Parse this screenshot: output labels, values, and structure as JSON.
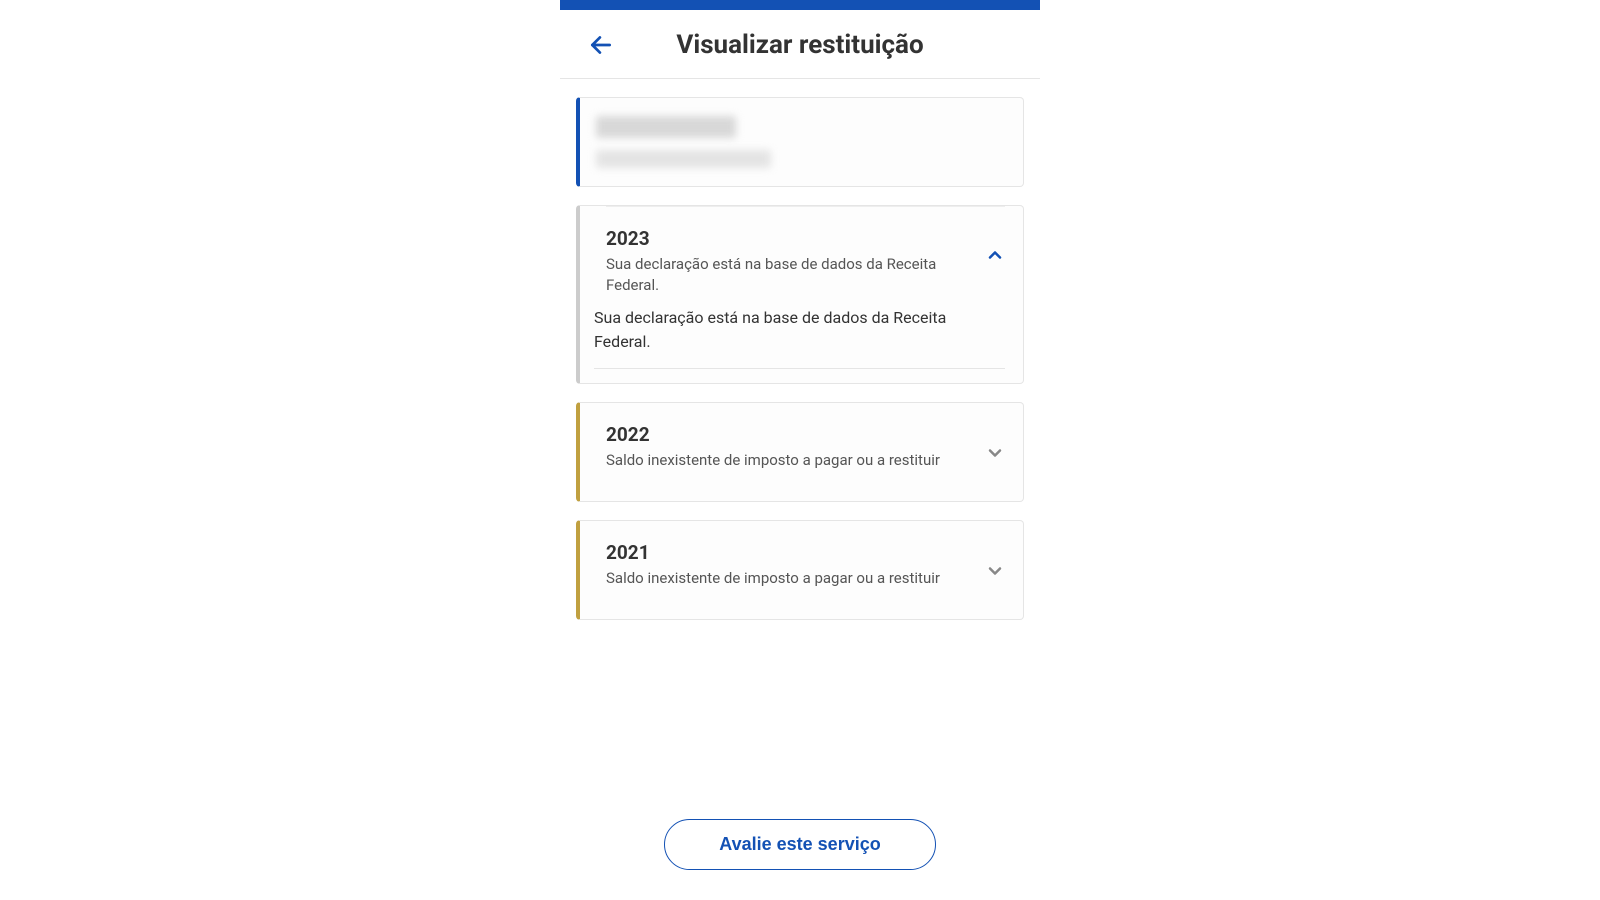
{
  "header": {
    "title": "Visualizar restituição"
  },
  "years": [
    {
      "year": "2023",
      "summary": "Sua declaração está na base de dados da Receita Federal.",
      "expanded": true,
      "detail": "Sua declaração está na base de dados da Receita Federal."
    },
    {
      "year": "2022",
      "summary": "Saldo inexistente de imposto a pagar ou a restituir",
      "expanded": false
    },
    {
      "year": "2021",
      "summary": "Saldo inexistente de imposto a pagar ou a restituir",
      "expanded": false
    }
  ],
  "footer": {
    "rate_button": "Avalie este serviço"
  }
}
